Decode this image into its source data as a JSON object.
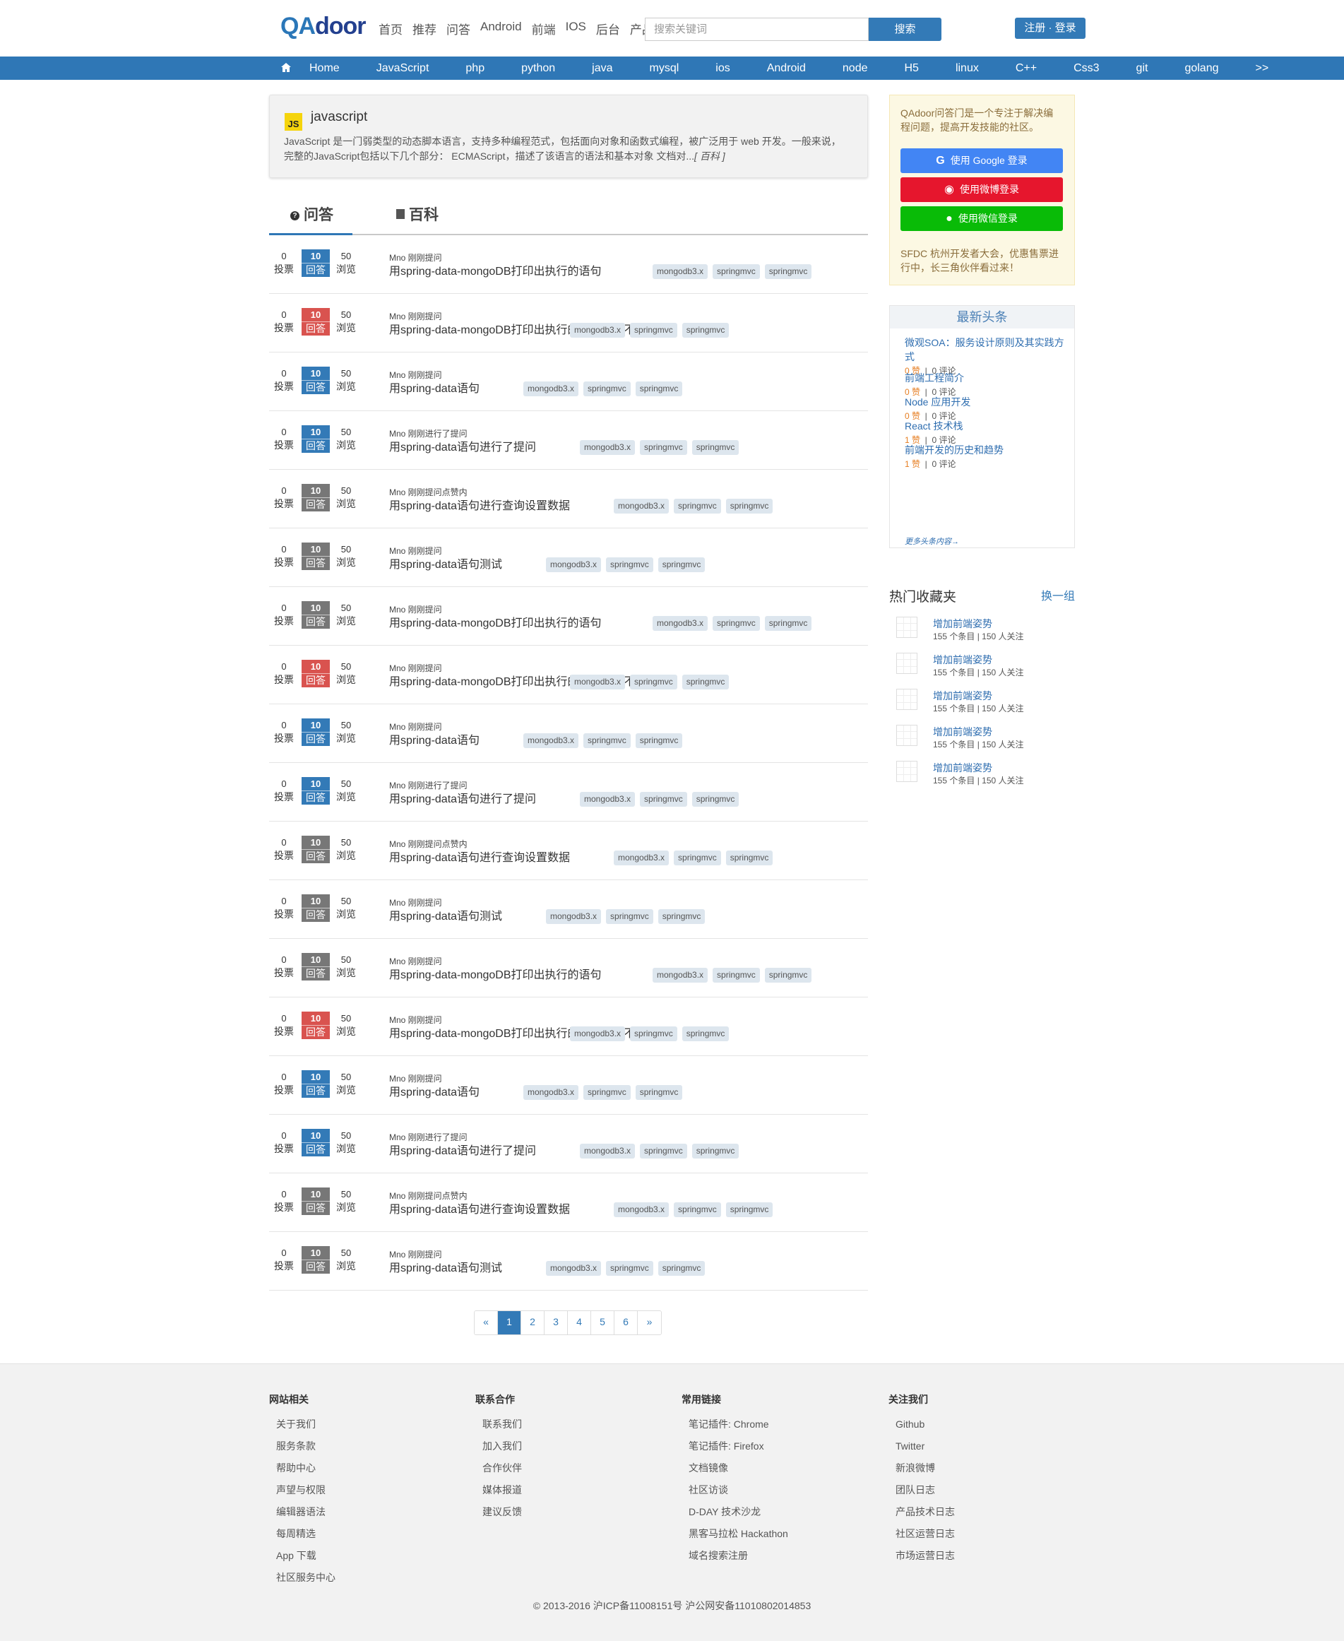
{
  "header": {
    "logo_q": "QA",
    "logo_rest": "door",
    "nav": [
      "首页",
      "推荐",
      "问答",
      "Android",
      "前端",
      "IOS",
      "后台",
      "产品"
    ],
    "search_placeholder": "搜索关键词",
    "search_button": "搜索",
    "auth_button": "注册 · 登录"
  },
  "categories": [
    "Home",
    "JavaScript",
    "php",
    "python",
    "java",
    "mysql",
    "ios",
    "Android",
    "node",
    "H5",
    "linux",
    "C++",
    "Css3",
    "git",
    "golang",
    ">>"
  ],
  "intro": {
    "icon": "JS",
    "title": "javascript",
    "text": "JavaScript 是一门弱类型的动态脚本语言，支持多种编程范式，包括面向对象和函数式编程，被广泛用于 web 开发。一般来说，完整的JavaScript包括以下几个部分： ECMAScript，描述了该语言的语法和基本对象 文档对...",
    "more": "[ 百科 ]"
  },
  "tabs": [
    "问答",
    "百科"
  ],
  "labels": {
    "votes": "投票",
    "answers": "回答",
    "views": "浏览"
  },
  "questions": [
    {
      "votes": "0",
      "answers": "10",
      "views": "50",
      "state": "blue",
      "who": "Mno 刚刚提问",
      "title": "用spring-data-mongoDB打印出执行的语句",
      "tags": [
        "mongodb3.x",
        "springmvc",
        "springmvc"
      ]
    },
    {
      "votes": "0",
      "answers": "10",
      "views": "50",
      "state": "red",
      "who": "Mno 刚刚提问",
      "title": "用spring-data-mongoDB打印出执行的语句可以不",
      "tags": [
        "mongodb3.x",
        "springmvc",
        "springmvc"
      ]
    },
    {
      "votes": "0",
      "answers": "10",
      "views": "50",
      "state": "blue",
      "who": "Mno 刚刚提问",
      "title": "用spring-data语句",
      "tags": [
        "mongodb3.x",
        "springmvc",
        "springmvc"
      ]
    },
    {
      "votes": "0",
      "answers": "10",
      "views": "50",
      "state": "blue",
      "who": "Mno 刚刚进行了提问",
      "title": "用spring-data语句进行了提问",
      "tags": [
        "mongodb3.x",
        "springmvc",
        "springmvc"
      ]
    },
    {
      "votes": "0",
      "answers": "10",
      "views": "50",
      "state": "gray",
      "who": "Mno 刚刚提问点赞内",
      "title": "用spring-data语句进行查询设置数据",
      "tags": [
        "mongodb3.x",
        "springmvc",
        "springmvc"
      ]
    },
    {
      "votes": "0",
      "answers": "10",
      "views": "50",
      "state": "gray",
      "who": "Mno 刚刚提问",
      "title": "用spring-data语句测试",
      "tags": [
        "mongodb3.x",
        "springmvc",
        "springmvc"
      ]
    },
    {
      "votes": "0",
      "answers": "10",
      "views": "50",
      "state": "gray",
      "who": "Mno 刚刚提问",
      "title": "用spring-data-mongoDB打印出执行的语句",
      "tags": [
        "mongodb3.x",
        "springmvc",
        "springmvc"
      ]
    },
    {
      "votes": "0",
      "answers": "10",
      "views": "50",
      "state": "red",
      "who": "Mno 刚刚提问",
      "title": "用spring-data-mongoDB打印出执行的语句可以不",
      "tags": [
        "mongodb3.x",
        "springmvc",
        "springmvc"
      ]
    },
    {
      "votes": "0",
      "answers": "10",
      "views": "50",
      "state": "blue",
      "who": "Mno 刚刚提问",
      "title": "用spring-data语句",
      "tags": [
        "mongodb3.x",
        "springmvc",
        "springmvc"
      ]
    },
    {
      "votes": "0",
      "answers": "10",
      "views": "50",
      "state": "blue",
      "who": "Mno 刚刚进行了提问",
      "title": "用spring-data语句进行了提问",
      "tags": [
        "mongodb3.x",
        "springmvc",
        "springmvc"
      ]
    },
    {
      "votes": "0",
      "answers": "10",
      "views": "50",
      "state": "gray",
      "who": "Mno 刚刚提问点赞内",
      "title": "用spring-data语句进行查询设置数据",
      "tags": [
        "mongodb3.x",
        "springmvc",
        "springmvc"
      ]
    },
    {
      "votes": "0",
      "answers": "10",
      "views": "50",
      "state": "gray",
      "who": "Mno 刚刚提问",
      "title": "用spring-data语句测试",
      "tags": [
        "mongodb3.x",
        "springmvc",
        "springmvc"
      ]
    },
    {
      "votes": "0",
      "answers": "10",
      "views": "50",
      "state": "gray",
      "who": "Mno 刚刚提问",
      "title": "用spring-data-mongoDB打印出执行的语句",
      "tags": [
        "mongodb3.x",
        "springmvc",
        "springmvc"
      ]
    },
    {
      "votes": "0",
      "answers": "10",
      "views": "50",
      "state": "red",
      "who": "Mno 刚刚提问",
      "title": "用spring-data-mongoDB打印出执行的语句可以不",
      "tags": [
        "mongodb3.x",
        "springmvc",
        "springmvc"
      ]
    },
    {
      "votes": "0",
      "answers": "10",
      "views": "50",
      "state": "blue",
      "who": "Mno 刚刚提问",
      "title": "用spring-data语句",
      "tags": [
        "mongodb3.x",
        "springmvc",
        "springmvc"
      ]
    },
    {
      "votes": "0",
      "answers": "10",
      "views": "50",
      "state": "blue",
      "who": "Mno 刚刚进行了提问",
      "title": "用spring-data语句进行了提问",
      "tags": [
        "mongodb3.x",
        "springmvc",
        "springmvc"
      ]
    },
    {
      "votes": "0",
      "answers": "10",
      "views": "50",
      "state": "gray",
      "who": "Mno 刚刚提问点赞内",
      "title": "用spring-data语句进行查询设置数据",
      "tags": [
        "mongodb3.x",
        "springmvc",
        "springmvc"
      ]
    },
    {
      "votes": "0",
      "answers": "10",
      "views": "50",
      "state": "gray",
      "who": "Mno 刚刚提问",
      "title": "用spring-data语句测试",
      "tags": [
        "mongodb3.x",
        "springmvc",
        "springmvc"
      ]
    }
  ],
  "pager": [
    "«",
    "1",
    "2",
    "3",
    "4",
    "5",
    "6",
    "»"
  ],
  "pager_active": "1",
  "sidebar": {
    "welcome": "QAdoor问答门是一个专注于解决编程问题，提高开发技能的社区。",
    "google_login": "使用 Google 登录",
    "weibo_login": "使用微博登录",
    "wechat_login": "使用微信登录",
    "promo": "SFDC 杭州开发者大会，优惠售票进行中，长三角伙伴看过来！",
    "news_title": "最新头条",
    "news": [
      {
        "title": "微观SOA：服务设计原则及其实践方式",
        "likes": "0 赞",
        "comments": "0 评论"
      },
      {
        "title": "前端工程简介",
        "likes": "0 赞",
        "comments": "0 评论"
      },
      {
        "title": "Node 应用开发",
        "likes": "0 赞",
        "comments": "0 评论"
      },
      {
        "title": "React 技术栈",
        "likes": "1 赞",
        "comments": "0 评论"
      },
      {
        "title": "前端开发的历史和趋势",
        "likes": "1 赞",
        "comments": "0 评论"
      }
    ],
    "news_more": "更多头条内容→",
    "fav_title": "热门收藏夹",
    "fav_switch": "换一组",
    "favs": [
      {
        "title": "增加前端姿势",
        "meta": "155 个条目 | 150 人关注"
      },
      {
        "title": "增加前端姿势",
        "meta": "155 个条目 | 150 人关注"
      },
      {
        "title": "增加前端姿势",
        "meta": "155 个条目 | 150 人关注"
      },
      {
        "title": "增加前端姿势",
        "meta": "155 个条目 | 150 人关注"
      },
      {
        "title": "增加前端姿势",
        "meta": "155 个条目 | 150 人关注"
      }
    ]
  },
  "footer": {
    "cols": [
      {
        "title": "网站相关",
        "items": [
          "关于我们",
          "服务条款",
          "帮助中心",
          "声望与权限",
          "编辑器语法",
          "每周精选",
          "App 下载",
          "社区服务中心"
        ]
      },
      {
        "title": "联系合作",
        "items": [
          "联系我们",
          "加入我们",
          "合作伙伴",
          "媒体报道",
          "建议反馈"
        ]
      },
      {
        "title": "常用链接",
        "items": [
          "笔记插件: Chrome",
          "笔记插件: Firefox",
          "文档镜像",
          "社区访谈",
          "D-DAY 技术沙龙",
          "黑客马拉松 Hackathon",
          "域名搜索注册"
        ]
      },
      {
        "title": "关注我们",
        "items": [
          "Github",
          "Twitter",
          "新浪微博",
          "团队日志",
          "产品技术日志",
          "社区运营日志",
          "市场运营日志"
        ]
      }
    ],
    "copyright": "© 2013-2016 沪ICP备11008151号 沪公网安备11010802014853"
  }
}
